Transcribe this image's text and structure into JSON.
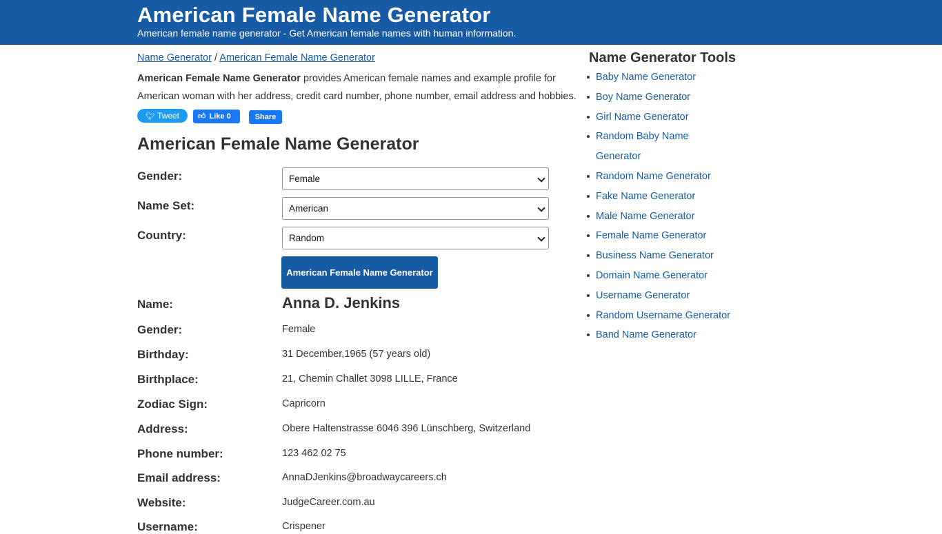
{
  "header": {
    "title": "American Female Name Generator",
    "subtitle": "American female name generator - Get American female names with human information."
  },
  "breadcrumb": {
    "home": "Name Generator",
    "separator": " / ",
    "current": "American Female Name Generator"
  },
  "intro": {
    "bold": "American Female Name Generator",
    "text": " provides American female names and example profile for American woman with her address, credit card number, phone number, email address and hobbies."
  },
  "social": {
    "tweet": "Tweet",
    "like": "Like 0",
    "share": "Share"
  },
  "form": {
    "title": "American Female Name Generator",
    "gender_label": "Gender:",
    "gender_value": "Female",
    "nameset_label": "Name Set:",
    "nameset_value": "American",
    "country_label": "Country:",
    "country_value": "Random",
    "submit_label": "American Female Name Generator"
  },
  "result": {
    "name_label": "Name:",
    "name": "Anna D. Jenkins",
    "rows": [
      {
        "label": "Gender:",
        "value": "Female"
      },
      {
        "label": "Birthday:",
        "value": "31 December,1965 (57 years old)"
      },
      {
        "label": "Birthplace:",
        "value": "21, Chemin Challet 3098 LILLE, France"
      },
      {
        "label": "Zodiac Sign:",
        "value": "Capricorn"
      },
      {
        "label": "Address:",
        "value": "Obere Haltenstrasse 6046 396 Lünschberg, Switzerland"
      },
      {
        "label": "Phone number:",
        "value": "123 462 02 75"
      },
      {
        "label": "Email address:",
        "value": "AnnaDJenkins@broadwaycareers.ch"
      },
      {
        "label": "Website:",
        "value": "JudgeCareer.com.au"
      },
      {
        "label": "Username:",
        "value": "Crispener"
      }
    ]
  },
  "sidebar": {
    "title": "Name Generator Tools",
    "items": [
      "Baby Name Generator",
      "Boy Name Generator",
      "Girl Name Generator",
      "Random Baby Name Generator",
      "Random Name Generator",
      "Fake Name Generator",
      "Male Name Generator",
      "Female Name Generator",
      "Business Name Generator",
      "Domain Name Generator",
      "Username Generator",
      "Random Username Generator",
      "Band Name Generator"
    ]
  },
  "colors": {
    "brand": "#175ba4",
    "tweet": "#1d9bf0",
    "facebook": "#1877f2"
  }
}
